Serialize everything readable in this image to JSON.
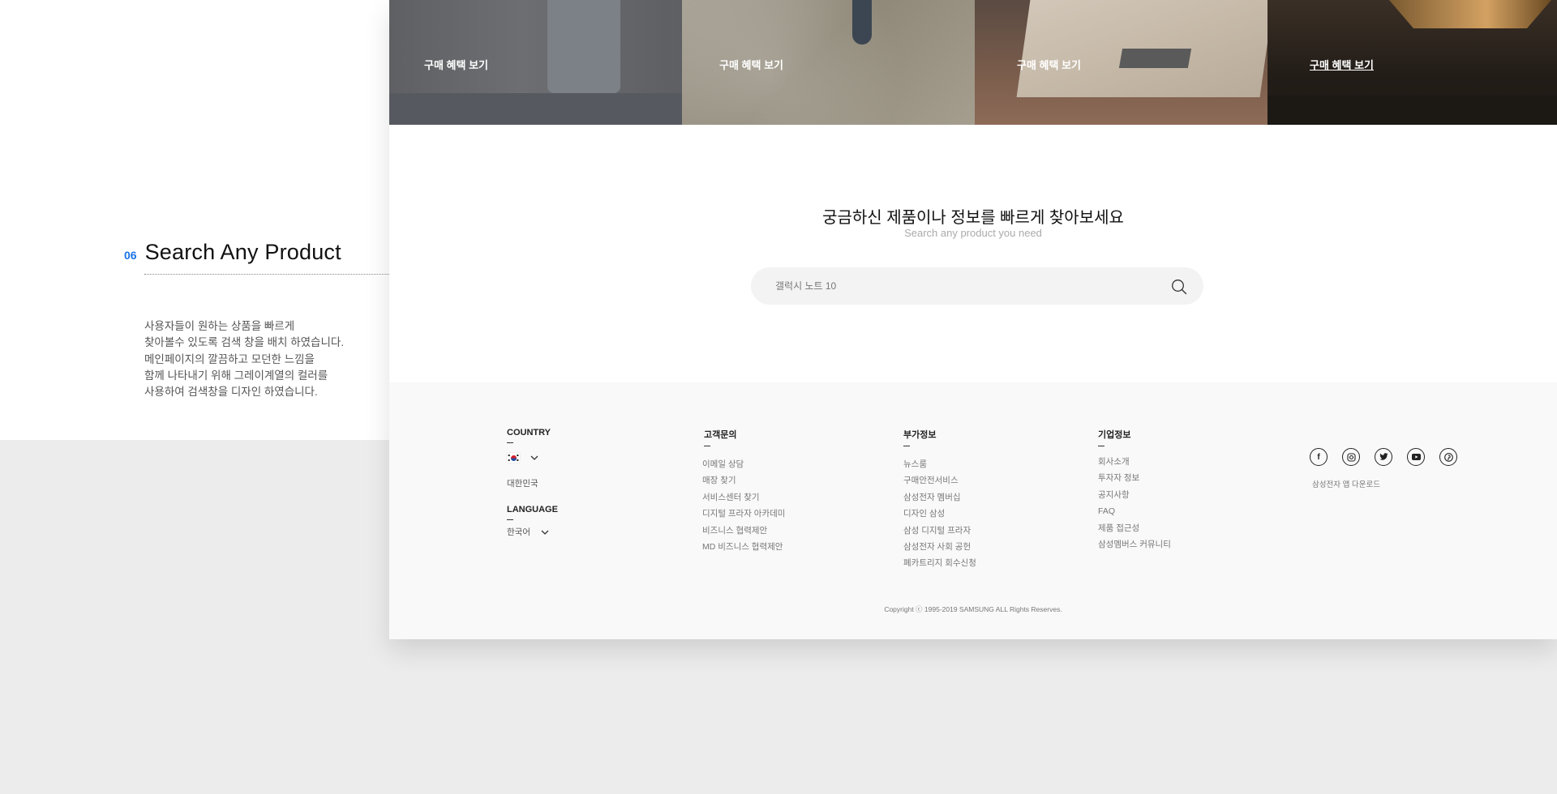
{
  "section": {
    "number": "06",
    "title": "Search Any Product",
    "description": [
      "사용자들이 원하는 상품을 빠르게",
      "찾아볼수 있도록 검색 창을 배치 하였습니다.",
      "메인페이지의 깔끔하고 모던한 느낌을",
      "함께 나타내기 위해 그레이계열의 컬러를",
      "사용하여 검색창을 디자인 하였습니다."
    ]
  },
  "banners": [
    {
      "label": "구매 혜택 보기"
    },
    {
      "label": "구매 혜택 보기"
    },
    {
      "label": "구매 혜택 보기"
    },
    {
      "label": "구매 혜택 보기"
    }
  ],
  "search": {
    "title": "궁금하신 제품이나 정보를 빠르게 찾아보세요",
    "subtitle": "Search any product you need",
    "placeholder": "갤럭시 노트 10",
    "icon": "search-icon"
  },
  "footer": {
    "country": {
      "heading": "COUNTRY",
      "flag_icon": "korea-flag-icon",
      "name": "대한민국"
    },
    "language": {
      "heading": "LANGUAGE",
      "value": "한국어"
    },
    "columns": [
      {
        "heading": "고객문의",
        "links": [
          "이메일 상담",
          "매장 찾기",
          "서비스센터 찾기",
          "디지털 프라자 아카데미",
          "비즈니스 협력제안",
          "MD 비즈니스 협력제안"
        ]
      },
      {
        "heading": "부가정보",
        "links": [
          "뉴스룸",
          "구매안전서비스",
          "삼성전자 멤버십",
          "디자인 삼성",
          "삼성 디지털 프라자",
          "삼성전자 사회 공헌",
          "폐카트리지 회수신청"
        ]
      },
      {
        "heading": "기업정보",
        "links": [
          "회사소개",
          "투자자 정보",
          "공지사항",
          "FAQ",
          "제품 접근성",
          "삼성멤버스 커뮤니티"
        ]
      }
    ],
    "socials": [
      "facebook-icon",
      "instagram-icon",
      "twitter-icon",
      "youtube-icon",
      "pinterest-icon"
    ],
    "app_download": "삼성전자 앱 다운로드",
    "copyright": "Copyright ⓒ 1995-2019 SAMSUNG ALL Rights Reserves."
  },
  "colors": {
    "accent": "#1a73e8",
    "page_bg": "#ececec",
    "search_bg": "#f3f3f3",
    "footer_bg": "#f9f9f9"
  }
}
